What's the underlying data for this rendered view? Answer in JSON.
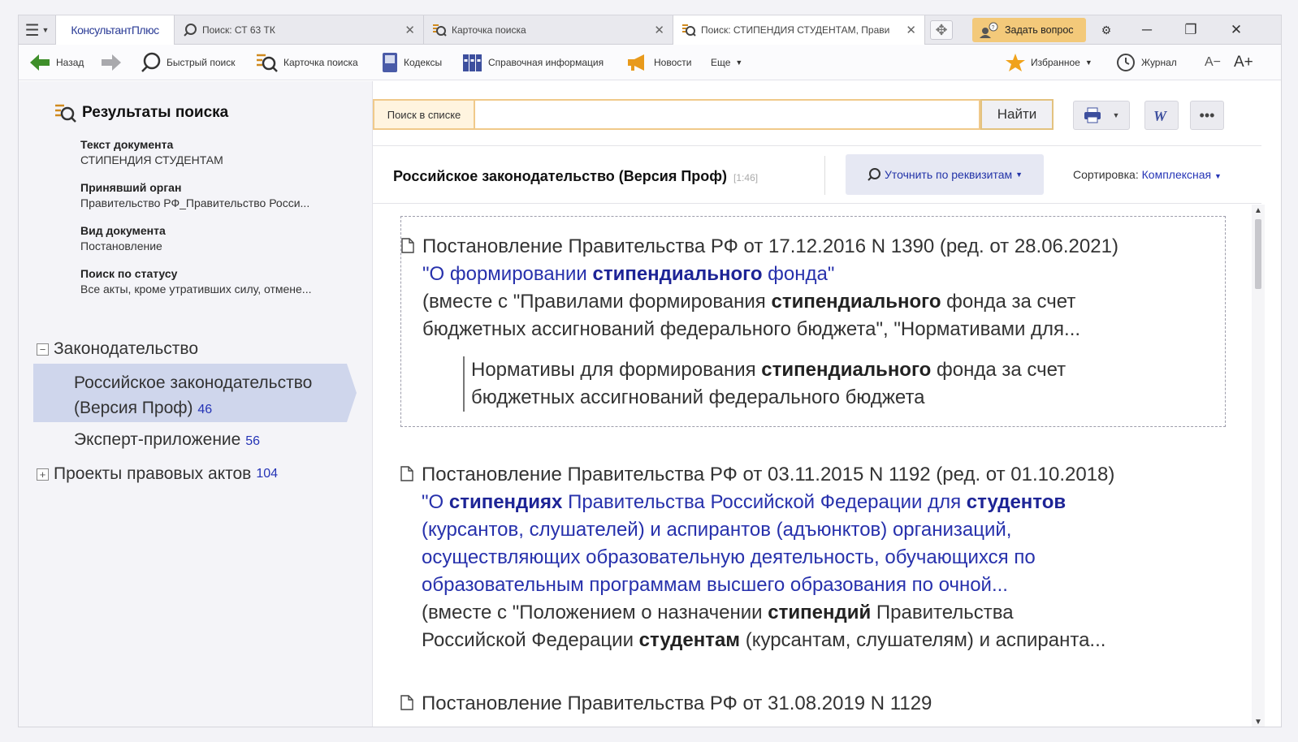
{
  "app": {
    "logo": "КонсультантПлюс"
  },
  "tabs": [
    {
      "label": "Поиск: СТ 63 ТК",
      "close": "✕"
    },
    {
      "label": "Карточка поиска",
      "close": "✕"
    },
    {
      "label": "Поиск: СТИПЕНДИЯ СТУДЕНТАМ, Прави",
      "close": "✕"
    }
  ],
  "ask_button": "Задать вопрос",
  "toolbar": {
    "back": "Назад",
    "quick_search": "Быстрый поиск",
    "search_card": "Карточка поиска",
    "codes": "Кодексы",
    "reference": "Справочная информация",
    "news": "Новости",
    "more": "Еще",
    "favorites": "Избранное",
    "journal": "Журнал",
    "font_smaller": "A−",
    "font_larger": "A+"
  },
  "left": {
    "title": "Результаты поиска",
    "criteria": [
      {
        "label": "Текст документа",
        "value": "СТИПЕНДИЯ СТУДЕНТАМ"
      },
      {
        "label": "Принявший орган",
        "value": "Правительство РФ_Правительство Росси..."
      },
      {
        "label": "Вид документа",
        "value": "Постановление"
      },
      {
        "label": "Поиск по статусу",
        "value": "Все акты, кроме утративших силу, отмене..."
      }
    ],
    "tree": {
      "group1": {
        "box": "−",
        "label": "Законодательство"
      },
      "active_line1": "Российское законодательство",
      "active_line2": "(Версия Проф)",
      "active_count": "46",
      "leaf_label": "Эксперт-приложение",
      "leaf_count": "56",
      "group2": {
        "box": "+",
        "label": "Проекты правовых актов",
        "count": "104"
      }
    }
  },
  "search": {
    "label": "Поиск в списке",
    "value": "",
    "button": "Найти"
  },
  "list_header": {
    "title": "Российское законодательство (Версия Проф)",
    "time": "[1:46]",
    "refine": "Уточнить по реквизитам",
    "sort_label": "Сортировка:",
    "sort_value": "Комплексная"
  },
  "results": {
    "doc1": {
      "title": "Постановление Правительства РФ от 17.12.2016 N 1390 (ред. от 28.06.2021)",
      "name_a": "\"О формировании ",
      "name_b": "стипендиального",
      "name_c": " фонда\"",
      "with1_a": "(вместе с \"Правилами формирования ",
      "with1_b": "стипендиального",
      "with1_c": " фонда за счет",
      "with2": "бюджетных ассигнований федерального бюджета\", \"Нормативами для...",
      "quote1_a": "Нормативы для формирования ",
      "quote1_b": "стипендиального",
      "quote1_c": " фонда за счет",
      "quote2": "бюджетных ассигнований федерального бюджета"
    },
    "doc2": {
      "title": "Постановление Правительства РФ от 03.11.2015 N 1192 (ред. от 01.10.2018)",
      "n1_a": "\"О ",
      "n1_b": "стипендиях",
      "n1_c": " Правительства Российской Федерации для ",
      "n1_d": "студентов",
      "n2": "(курсантов, слушателей) и аспирантов (адъюнктов) организаций,",
      "n3": "осуществляющих образовательную деятельность, обучающихся по",
      "n4": "образовательным программам высшего образования по очной...",
      "w1_a": "(вместе с \"Положением о назначении ",
      "w1_b": "стипендий",
      "w1_c": " Правительства",
      "w2_a": "Российской Федерации ",
      "w2_b": "студентам",
      "w2_c": " (курсантам, слушателям) и аспиранта..."
    },
    "doc3": {
      "title": "Постановление Правительства РФ от 31.08.2019 N 1129"
    }
  },
  "colors": {
    "accent_blue": "#2534b6",
    "highlight": "#cfd6ec",
    "ask_button": "#f3c97a"
  }
}
